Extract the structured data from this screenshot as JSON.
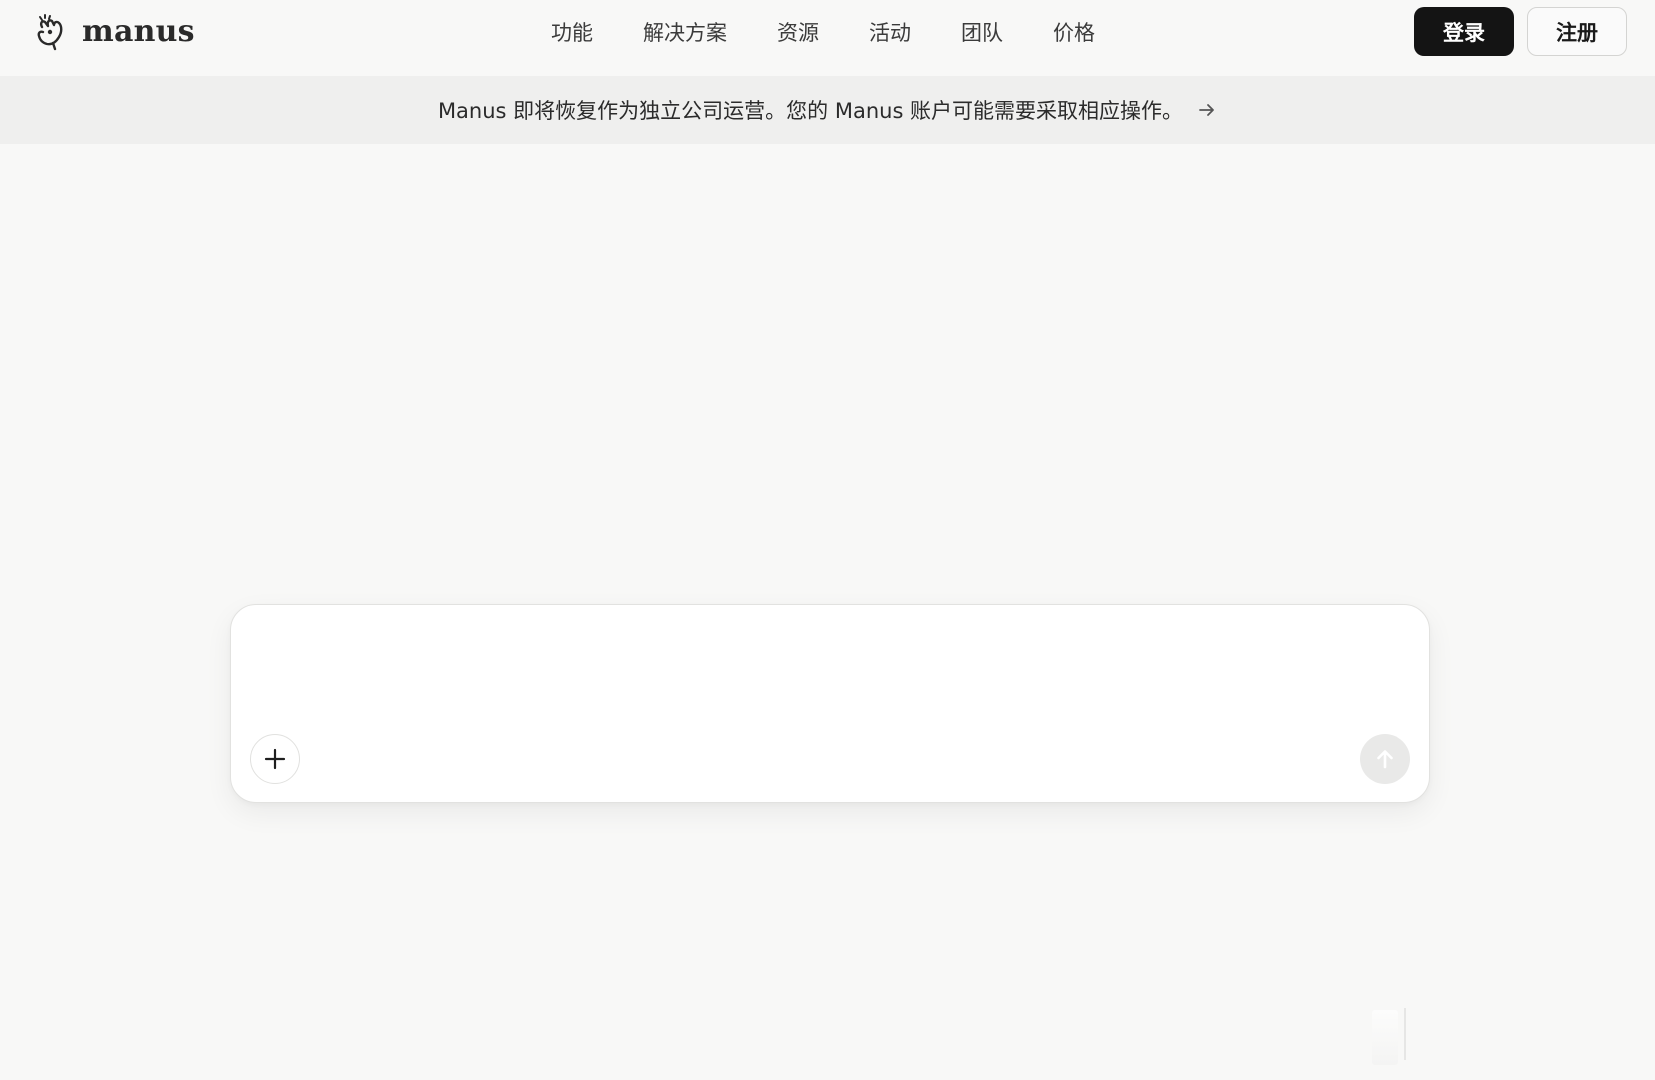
{
  "brand": {
    "name": "manus",
    "icon": "manus-hand-logo-icon"
  },
  "nav": {
    "items": [
      {
        "label": "功能"
      },
      {
        "label": "解决方案"
      },
      {
        "label": "资源"
      },
      {
        "label": "活动"
      },
      {
        "label": "团队"
      },
      {
        "label": "价格"
      }
    ],
    "login_label": "登录",
    "signup_label": "注册"
  },
  "banner": {
    "text": "Manus 即将恢复作为独立公司运营。您的 Manus 账户可能需要采取相应操作。",
    "icon": "arrow-right-icon"
  },
  "composer": {
    "value": "",
    "placeholder": "",
    "attach_icon": "plus-icon",
    "send_icon": "arrow-up-icon"
  },
  "colors": {
    "background": "#f8f8f7",
    "banner_bg": "#efefee",
    "login_bg": "#141414",
    "send_bg": "#e9e9e8"
  }
}
